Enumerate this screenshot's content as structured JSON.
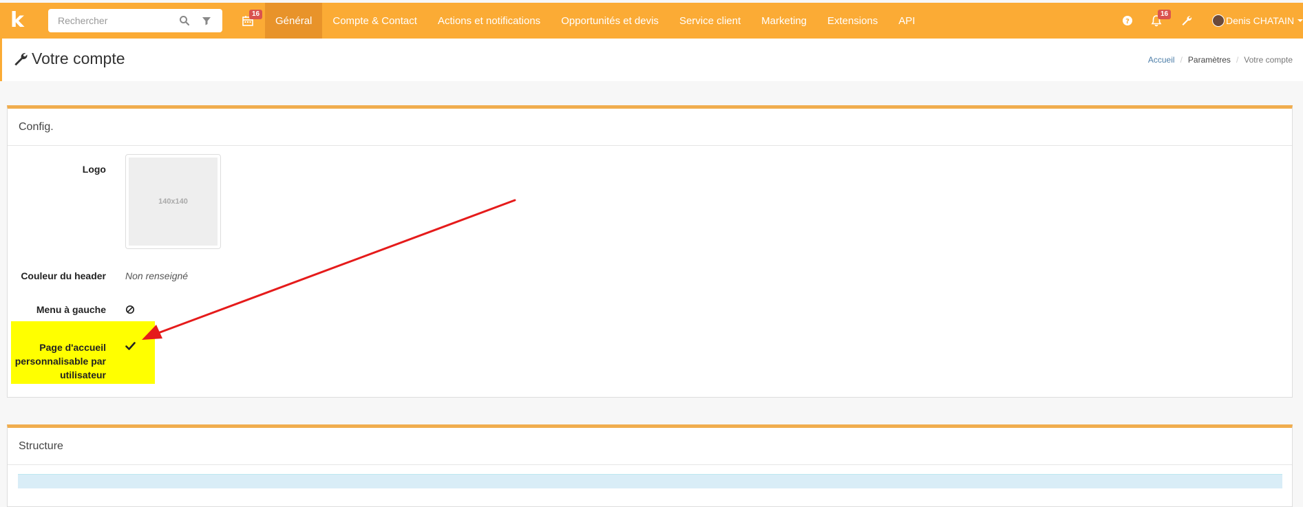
{
  "topbar": {
    "logo_letter": "k",
    "search_placeholder": "Rechercher",
    "calendar_badge": "16",
    "nav": [
      {
        "label": "Général",
        "active": true
      },
      {
        "label": "Compte & Contact"
      },
      {
        "label": "Actions et notifications"
      },
      {
        "label": "Opportunités et devis"
      },
      {
        "label": "Service client"
      },
      {
        "label": "Marketing"
      },
      {
        "label": "Extensions"
      },
      {
        "label": "API"
      }
    ],
    "notifications_badge": "16",
    "user_name": "Denis CHATAIN",
    "accent_color": "#fbab35"
  },
  "header": {
    "title": "Votre compte",
    "breadcrumb": {
      "home": "Accueil",
      "middle": "Paramètres",
      "current": "Votre compte"
    }
  },
  "config_panel": {
    "title": "Config.",
    "rows": {
      "logo_label": "Logo",
      "logo_placeholder": "140x140",
      "header_color_label": "Couleur du header",
      "header_color_value": "Non renseigné",
      "left_menu_label": "Menu à gauche",
      "homepage_label_line1": "Page d'accueil",
      "homepage_label_line2": "personnalisable par",
      "homepage_label_line3": "utilisateur"
    }
  },
  "structure_panel": {
    "title": "Structure"
  }
}
